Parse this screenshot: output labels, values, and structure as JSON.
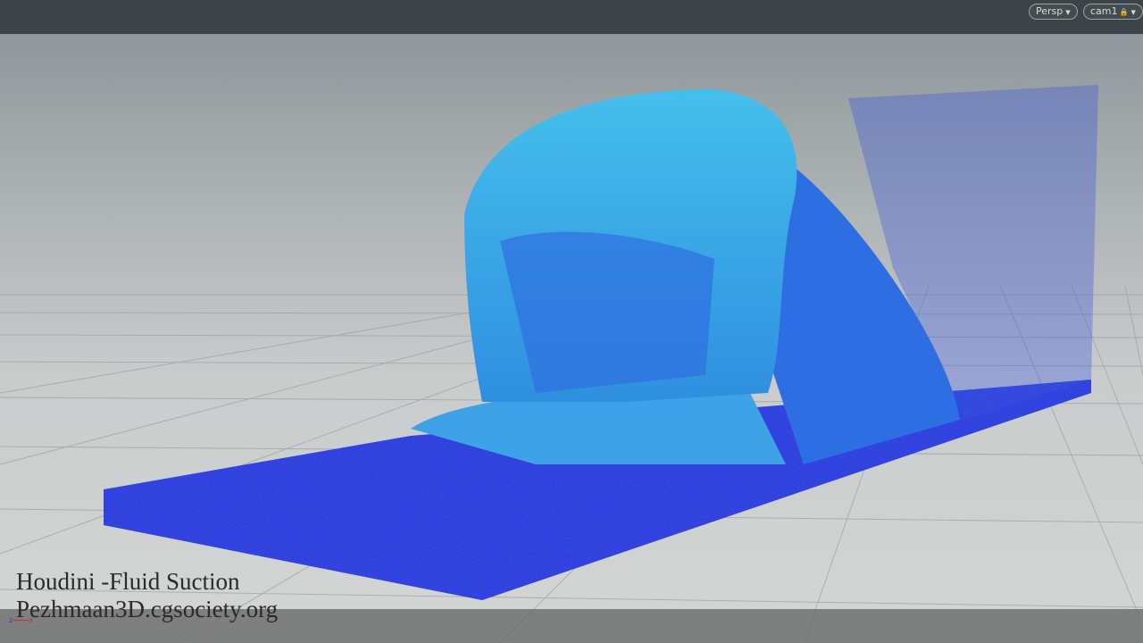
{
  "viewport": {
    "view_menu": "Persp",
    "camera_menu": "cam1",
    "lock_icon": "lock-icon",
    "dropdown_icon": "caret-down-icon",
    "axis": {
      "z": "z",
      "x": "x"
    }
  },
  "overlay": {
    "title": "Houdini -Fluid Suction",
    "credit": "Pezhmaan3D.cgsociety.org"
  },
  "colors": {
    "topbar": "#3d4448",
    "fluid_light": "#3fb6e8",
    "fluid_dark": "#1a2fd8"
  }
}
